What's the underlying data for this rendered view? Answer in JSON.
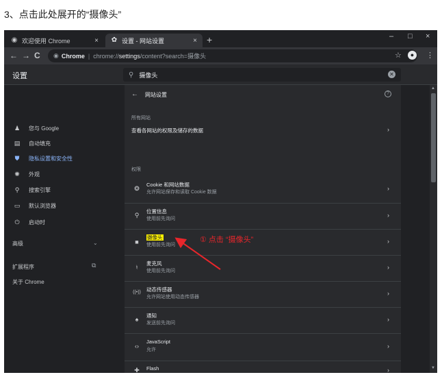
{
  "caption": "3、点击此处展开的“摄像头”",
  "browser": {
    "tabs": [
      {
        "title": "欢迎使用 Chrome",
        "icon": "chrome-icon",
        "active": false
      },
      {
        "title": "设置 - 网站设置",
        "icon": "gear-icon",
        "active": true
      }
    ],
    "new_tab": "+",
    "window_controls": [
      "–",
      "□",
      "×"
    ],
    "address": {
      "site": "Chrome",
      "url_prefix": "chrome://",
      "url_strong": "settings",
      "url_rest": "/content?search=摄像头"
    }
  },
  "settings": {
    "title": "设置",
    "search_value": "摄像头",
    "sidebar": {
      "items": [
        {
          "label": "您与 Google",
          "icon": "person-icon",
          "active": false
        },
        {
          "label": "自动填充",
          "icon": "clipboard-icon",
          "active": false
        },
        {
          "label": "隐私设置和安全性",
          "icon": "shield-icon",
          "active": true
        },
        {
          "label": "外观",
          "icon": "palette-icon",
          "active": false
        },
        {
          "label": "搜索引擎",
          "icon": "search-icon",
          "active": false
        },
        {
          "label": "默认浏览器",
          "icon": "browser-icon",
          "active": false
        },
        {
          "label": "启动时",
          "icon": "power-icon",
          "active": false
        }
      ],
      "advanced": "高级",
      "extensions": "扩展程序",
      "about": "关于 Chrome"
    },
    "content": {
      "header": "网站设置",
      "all_sites_label": "所有网站",
      "all_sites_row": "查看各网站的权限及储存的数据",
      "permissions_label": "权限",
      "rows": [
        {
          "title": "Cookie 和网站数据",
          "subtitle": "允许网站保存和读取 Cookie 数据",
          "icon": "cookie-icon"
        },
        {
          "title": "位置信息",
          "subtitle": "使用前先询问",
          "icon": "location-icon"
        },
        {
          "title": "摄像头",
          "subtitle": "使用前先询问",
          "icon": "camera-icon"
        },
        {
          "title": "麦克风",
          "subtitle": "使用前先询问",
          "icon": "microphone-icon"
        },
        {
          "title": "动态传感器",
          "subtitle": "允许网站使用动态传感器",
          "icon": "sensor-icon"
        },
        {
          "title": "通知",
          "subtitle": "发送前先询问",
          "icon": "bell-icon"
        },
        {
          "title": "JavaScript",
          "subtitle": "允许",
          "icon": "code-icon"
        },
        {
          "title": "Flash",
          "subtitle": "",
          "icon": "puzzle-icon"
        }
      ]
    }
  },
  "annotation": "① 点击 “摄像头”",
  "colors": {
    "annotation": "#e8262b",
    "highlight": "#fff200",
    "accent": "#8ab4f8"
  }
}
